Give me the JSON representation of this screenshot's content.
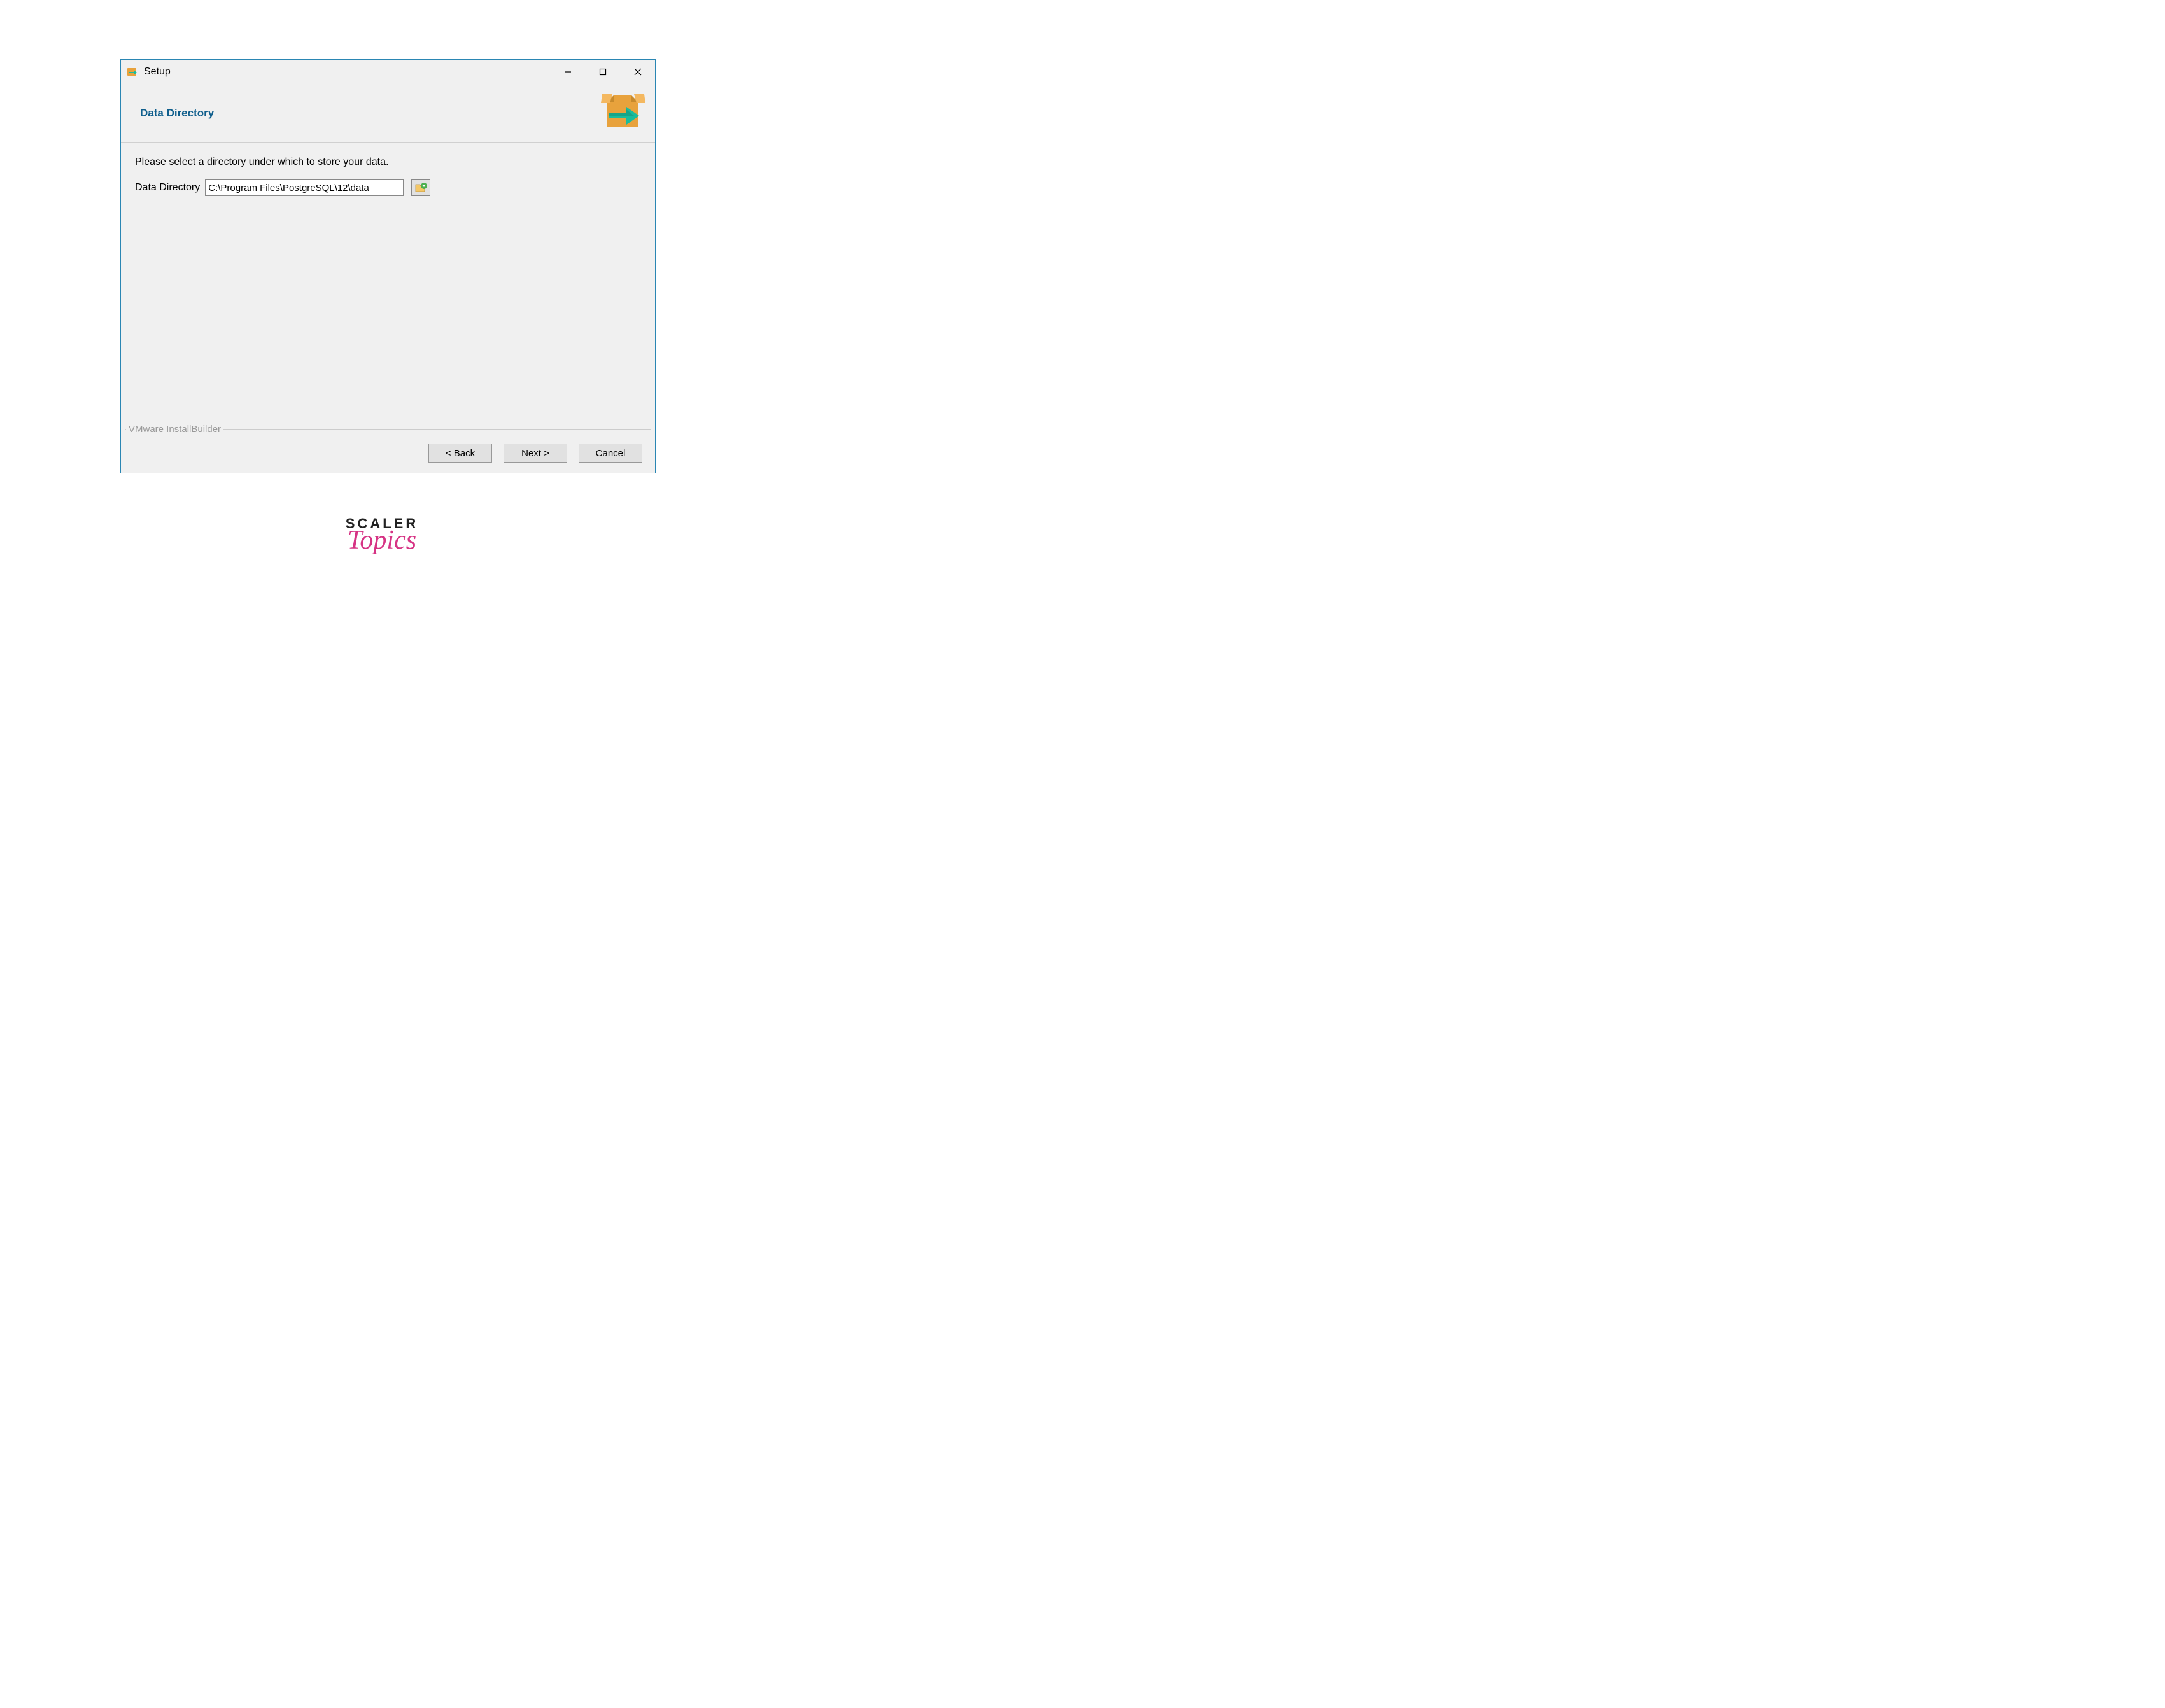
{
  "window": {
    "title": "Setup"
  },
  "header": {
    "title": "Data Directory"
  },
  "content": {
    "instruction": "Please select a directory under which to store your data.",
    "input_label": "Data Directory",
    "input_value": "C:\\Program Files\\PostgreSQL\\12\\data"
  },
  "footer": {
    "builder_label": "VMware InstallBuilder",
    "back_label": "< Back",
    "next_label": "Next >",
    "cancel_label": "Cancel"
  },
  "watermark": {
    "line1": "SCALER",
    "line2": "Topics"
  }
}
